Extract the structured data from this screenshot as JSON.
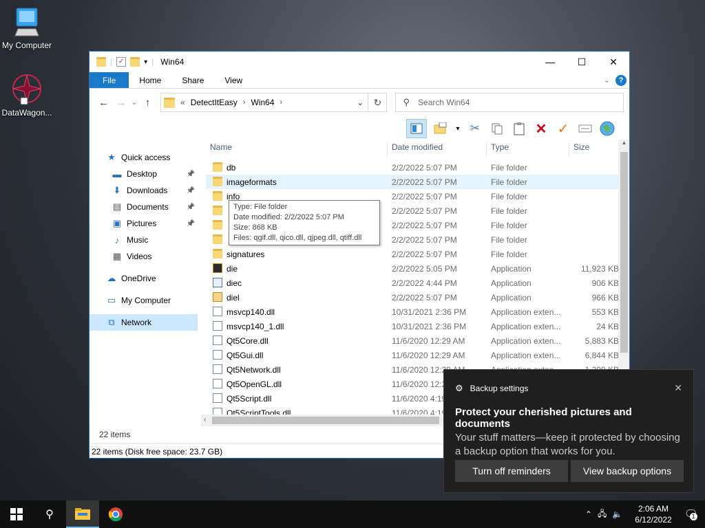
{
  "desktop": {
    "icons": [
      {
        "label": "My Computer"
      },
      {
        "label": "DataWagon..."
      }
    ]
  },
  "window": {
    "title": "Win64",
    "ribbon_tabs": [
      "File",
      "Home",
      "Share",
      "View"
    ],
    "address": {
      "prefix": "«",
      "crumbs": [
        "DetectItEasy",
        "Win64"
      ]
    },
    "search_placeholder": "Search Win64",
    "nav": [
      {
        "label": "Quick access",
        "icon": "star-icon"
      },
      {
        "label": "Desktop",
        "icon": "desktop-icon",
        "pinned": true
      },
      {
        "label": "Downloads",
        "icon": "download-icon",
        "pinned": true
      },
      {
        "label": "Documents",
        "icon": "documents-icon",
        "pinned": true
      },
      {
        "label": "Pictures",
        "icon": "pictures-icon",
        "pinned": true
      },
      {
        "label": "Music",
        "icon": "music-icon"
      },
      {
        "label": "Videos",
        "icon": "videos-icon"
      },
      {
        "label": "OneDrive",
        "icon": "cloud-icon"
      },
      {
        "label": "My Computer",
        "icon": "computer-icon"
      },
      {
        "label": "Network",
        "icon": "network-icon"
      }
    ],
    "columns": [
      "Name",
      "Date modified",
      "Type",
      "Size"
    ],
    "files": [
      {
        "name": "db",
        "date": "2/2/2022 5:07 PM",
        "type": "File folder",
        "size": "",
        "kind": "folder"
      },
      {
        "name": "imageformats",
        "date": "2/2/2022 5:07 PM",
        "type": "File folder",
        "size": "",
        "kind": "folder"
      },
      {
        "name": "info",
        "date": "2/2/2022 5:07 PM",
        "type": "File folder",
        "size": "",
        "kind": "folder"
      },
      {
        "name": "",
        "date": "2/2/2022 5:07 PM",
        "type": "File folder",
        "size": "",
        "kind": "folder"
      },
      {
        "name": "",
        "date": "2/2/2022 5:07 PM",
        "type": "File folder",
        "size": "",
        "kind": "folder"
      },
      {
        "name": "",
        "date": "2/2/2022 5:07 PM",
        "type": "File folder",
        "size": "",
        "kind": "folder"
      },
      {
        "name": "signatures",
        "date": "2/2/2022 5:07 PM",
        "type": "File folder",
        "size": "",
        "kind": "folder"
      },
      {
        "name": "die",
        "date": "2/2/2022 5:05 PM",
        "type": "Application",
        "size": "11,923 KB",
        "kind": "app"
      },
      {
        "name": "diec",
        "date": "2/2/2022 4:44 PM",
        "type": "Application",
        "size": "906 KB",
        "kind": "app2"
      },
      {
        "name": "diel",
        "date": "2/2/2022 5:07 PM",
        "type": "Application",
        "size": "966 KB",
        "kind": "app3"
      },
      {
        "name": "msvcp140.dll",
        "date": "10/31/2021 2:36 PM",
        "type": "Application exten...",
        "size": "553 KB",
        "kind": "dll"
      },
      {
        "name": "msvcp140_1.dll",
        "date": "10/31/2021 2:36 PM",
        "type": "Application exten...",
        "size": "24 KB",
        "kind": "dll"
      },
      {
        "name": "Qt5Core.dll",
        "date": "11/6/2020 12:29 AM",
        "type": "Application exten...",
        "size": "5,883 KB",
        "kind": "dll"
      },
      {
        "name": "Qt5Gui.dll",
        "date": "11/6/2020 12:29 AM",
        "type": "Application exten...",
        "size": "6,844 KB",
        "kind": "dll"
      },
      {
        "name": "Qt5Network.dll",
        "date": "11/6/2020 12:29 AM",
        "type": "Application exten...",
        "size": "1,309 KB",
        "kind": "dll"
      },
      {
        "name": "Qt5OpenGL.dll",
        "date": "11/6/2020 12:2",
        "type": "",
        "size": "",
        "kind": "dll"
      },
      {
        "name": "Qt5Script.dll",
        "date": "11/6/2020 4:19",
        "type": "",
        "size": "",
        "kind": "dll"
      },
      {
        "name": "Qt5ScriptTools.dll",
        "date": "11/6/2020 4:19",
        "type": "",
        "size": "",
        "kind": "dll"
      }
    ],
    "tooltip": [
      "Type: File folder",
      "Date modified: 2/2/2022 5:07 PM",
      "Size: 868 KB",
      "Files: qgif.dll, qico.dll, qjpeg.dll, qtiff.dll"
    ],
    "item_count": "22 items",
    "status": "22 items (Disk free space: 23.7 GB)"
  },
  "toast": {
    "app": "Backup settings",
    "title": "Protect your cherished pictures and documents",
    "body": "Your stuff matters—keep it protected by choosing a backup option that works for you.",
    "btn1": "Turn off reminders",
    "btn2": "View backup options"
  },
  "taskbar": {
    "time": "2:06 AM",
    "date": "6/12/2022",
    "notif_count": "1"
  }
}
